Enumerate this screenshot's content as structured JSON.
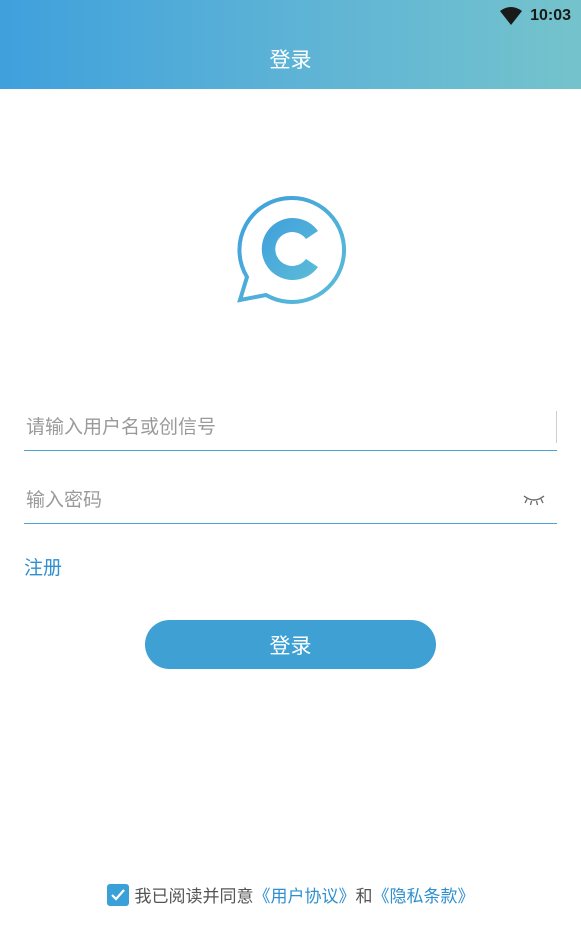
{
  "status_bar": {
    "time": "10:03",
    "wifi_icon": "wifi-icon"
  },
  "header": {
    "title": "登录"
  },
  "logo": {
    "icon": "chat-c-logo-icon",
    "color": "#3fa0dc"
  },
  "form": {
    "username_placeholder": "请输入用户名或创信号",
    "username_value": "",
    "password_placeholder": "输入密码",
    "password_value": "",
    "password_toggle_icon": "eye-closed-icon"
  },
  "register_label": "注册",
  "login_button_label": "登录",
  "agreement": {
    "checked": true,
    "prefix": "我已阅读并同意",
    "user_agreement": "《用户协议》",
    "conjunction": "和",
    "privacy_policy": "《隐私条款》"
  },
  "colors": {
    "accent": "#3fa0d4",
    "link": "#2f8fcf",
    "header_start": "#3fa0dc",
    "header_end": "#74c3cc"
  }
}
